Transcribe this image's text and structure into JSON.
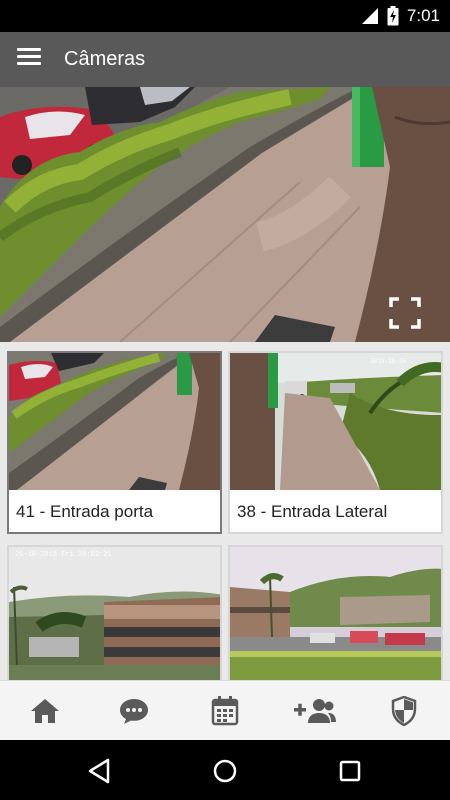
{
  "status_bar": {
    "time": "7:01"
  },
  "app_bar": {
    "title": "Câmeras"
  },
  "cameras": [
    {
      "label": "41 - Entrada porta",
      "selected": true
    },
    {
      "label": "38 - Entrada Lateral",
      "selected": false
    },
    {
      "label": "",
      "timestamp": "26-10-2018 Fri 20:02:21",
      "selected": false
    },
    {
      "label": "",
      "timestamp": "",
      "selected": false
    }
  ],
  "bottom_nav": [
    "home-icon",
    "chat-icon",
    "calendar-icon",
    "add-user-icon",
    "shield-icon"
  ],
  "colors": {
    "app_bar": "#595959",
    "nav_icon": "#5a5a5a",
    "background": "#e9e9e9"
  }
}
